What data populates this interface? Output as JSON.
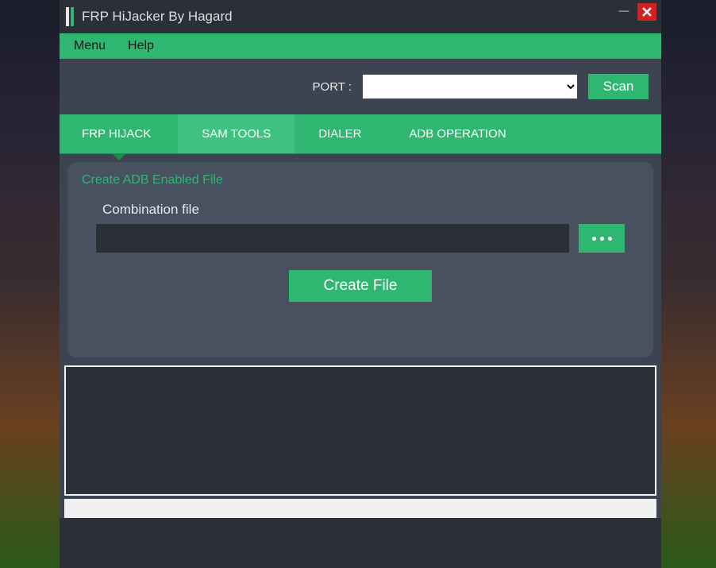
{
  "titlebar": {
    "title": "FRP HiJacker By Hagard"
  },
  "menu": {
    "items": [
      "Menu",
      "Help"
    ]
  },
  "port": {
    "label": "PORT :",
    "value": "",
    "scan_label": "Scan"
  },
  "tabs": {
    "items": [
      {
        "label": "FRP HIJACK"
      },
      {
        "label": "SAM TOOLS"
      },
      {
        "label": "DIALER"
      },
      {
        "label": "ADB OPERATION"
      }
    ]
  },
  "panel": {
    "title": "Create ADB Enabled File",
    "field_label": "Combination file",
    "file_value": "",
    "create_label": "Create File"
  }
}
